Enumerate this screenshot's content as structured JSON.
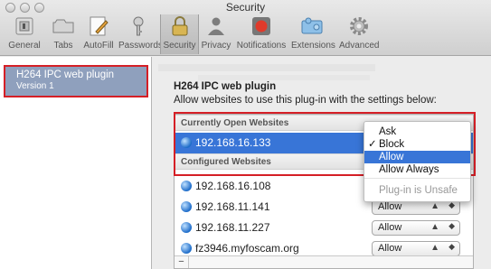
{
  "window": {
    "title": "Security"
  },
  "toolbar": {
    "items": [
      {
        "label": "General",
        "icon": "general-switch-icon"
      },
      {
        "label": "Tabs",
        "icon": "tabs-icon"
      },
      {
        "label": "AutoFill",
        "icon": "autofill-pencil-icon"
      },
      {
        "label": "Passwords",
        "icon": "key-icon"
      },
      {
        "label": "Security",
        "icon": "lock-icon",
        "active": true
      },
      {
        "label": "Privacy",
        "icon": "privacy-silhouette-icon"
      },
      {
        "label": "Notifications",
        "icon": "notifications-icon"
      },
      {
        "label": "Extensions",
        "icon": "extensions-puzzle-icon"
      },
      {
        "label": "Advanced",
        "icon": "gear-icon"
      }
    ]
  },
  "plugins": {
    "items": [
      {
        "name": "H264 IPC web plugin",
        "version": "Version 1"
      }
    ]
  },
  "plugin_settings": {
    "title": "H264 IPC web plugin",
    "description": "Allow websites to use this plug-in with the settings below:",
    "current_header": "Currently Open Websites",
    "current_sites": [
      {
        "host": "192.168.16.133",
        "setting": "Block"
      }
    ],
    "configured_header": "Configured Websites",
    "configured_sites": [
      {
        "host": "192.168.16.108",
        "setting": "Allow"
      },
      {
        "host": "192.168.11.141",
        "setting": "Allow"
      },
      {
        "host": "192.168.11.227",
        "setting": "Allow"
      },
      {
        "host": "fz3946.myfoscam.org",
        "setting": "Allow"
      }
    ],
    "remove_label": "−"
  },
  "dropdown": {
    "options": [
      {
        "label": "Ask"
      },
      {
        "label": "Block",
        "checked": true
      },
      {
        "label": "Allow",
        "highlighted": true
      },
      {
        "label": "Allow Always"
      }
    ],
    "footer_option": "Plug-in is Unsafe"
  },
  "colors": {
    "selection": "#3875d7",
    "highlight_border": "#d51f26",
    "plugin_item_bg": "#8fa0bd"
  }
}
